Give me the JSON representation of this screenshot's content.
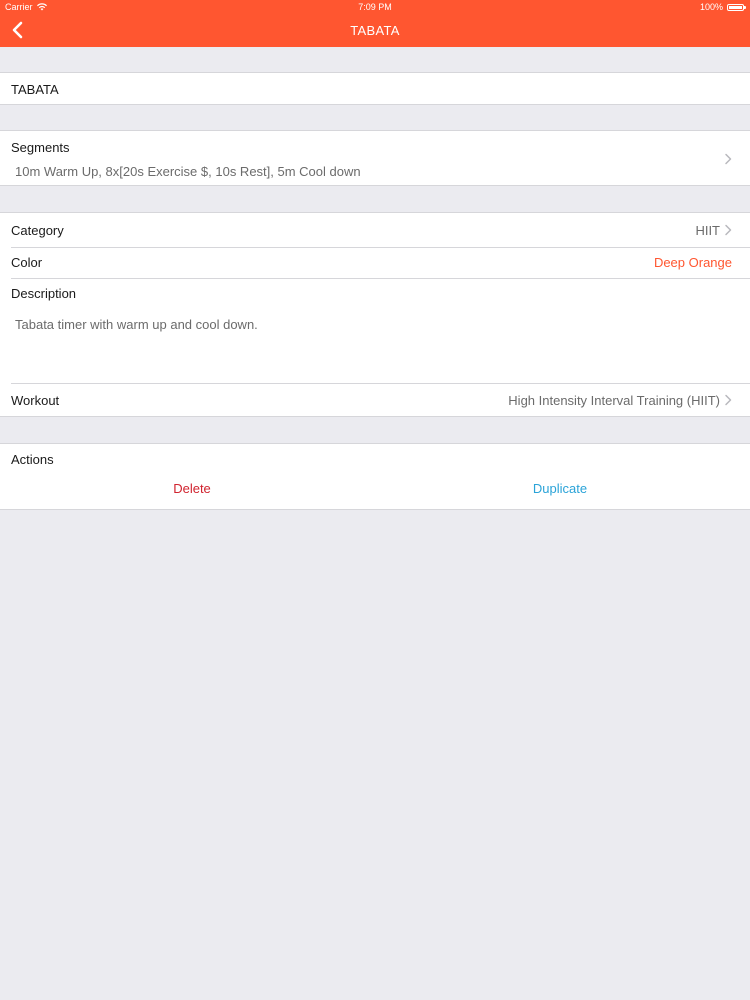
{
  "status_bar": {
    "carrier": "Carrier",
    "time": "7:09 PM",
    "battery": "100%",
    "battery_level": 1.0,
    "wifi_icon": "wifi-icon"
  },
  "nav": {
    "title": "TABATA",
    "back_icon": "chevron-left-icon"
  },
  "name_field": {
    "value": "TABATA"
  },
  "segments": {
    "label": "Segments",
    "value": "10m Warm Up, 8x[20s Exercise $, 10s Rest], 5m Cool down"
  },
  "details": {
    "category_label": "Category",
    "category_value": "HIIT",
    "color_label": "Color",
    "color_value": "Deep Orange",
    "description_label": "Description",
    "description_value": "Tabata timer with warm up and cool down.",
    "workout_label": "Workout",
    "workout_value": "High Intensity Interval Training (HIIT)"
  },
  "actions": {
    "label": "Actions",
    "delete_label": "Delete",
    "duplicate_label": "Duplicate"
  },
  "colors": {
    "brand": "#ff5630",
    "delete": "#d0232e",
    "duplicate": "#2aa3d8",
    "color_value": "#ff5630"
  }
}
